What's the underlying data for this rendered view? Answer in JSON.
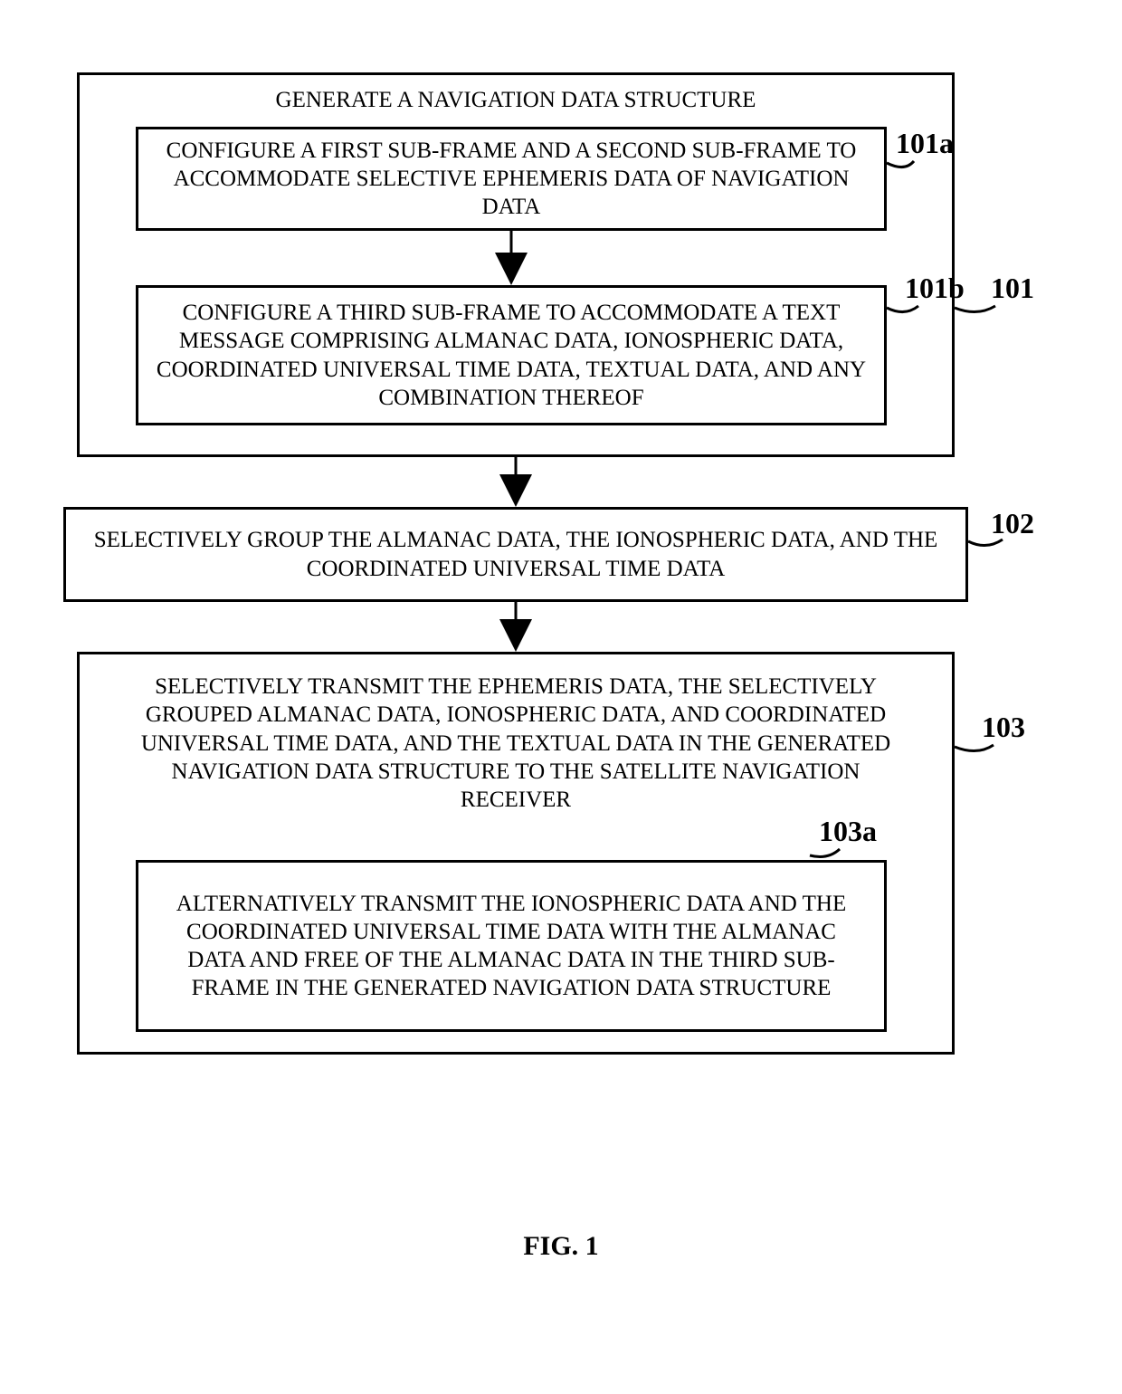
{
  "caption": "FIG. 1",
  "boxes": {
    "b101": {
      "title": "GENERATE A NAVIGATION DATA STRUCTURE",
      "ref": "101",
      "b101a": {
        "text": "CONFIGURE A FIRST SUB-FRAME AND A SECOND SUB-FRAME TO ACCOMMODATE SELECTIVE EPHEMERIS DATA OF NAVIGATION DATA",
        "ref": "101a"
      },
      "b101b": {
        "text": "CONFIGURE A THIRD SUB-FRAME TO ACCOMMODATE A TEXT MESSAGE COMPRISING ALMANAC DATA, IONOSPHERIC DATA, COORDINATED UNIVERSAL TIME DATA, TEXTUAL DATA, AND ANY COMBINATION THEREOF",
        "ref": "101b"
      }
    },
    "b102": {
      "text": "SELECTIVELY GROUP THE ALMANAC DATA, THE IONOSPHERIC DATA, AND THE COORDINATED UNIVERSAL TIME DATA",
      "ref": "102"
    },
    "b103": {
      "text": "SELECTIVELY TRANSMIT THE EPHEMERIS DATA, THE SELECTIVELY GROUPED ALMANAC DATA, IONOSPHERIC DATA, AND COORDINATED UNIVERSAL TIME DATA, AND THE TEXTUAL DATA IN THE GENERATED NAVIGATION DATA STRUCTURE TO THE SATELLITE NAVIGATION RECEIVER",
      "ref": "103",
      "b103a": {
        "text": "ALTERNATIVELY TRANSMIT THE IONOSPHERIC DATA AND THE COORDINATED UNIVERSAL TIME DATA WITH THE ALMANAC DATA AND FREE OF THE ALMANAC DATA IN THE THIRD SUB-FRAME IN THE GENERATED NAVIGATION DATA STRUCTURE",
        "ref": "103a"
      }
    }
  }
}
